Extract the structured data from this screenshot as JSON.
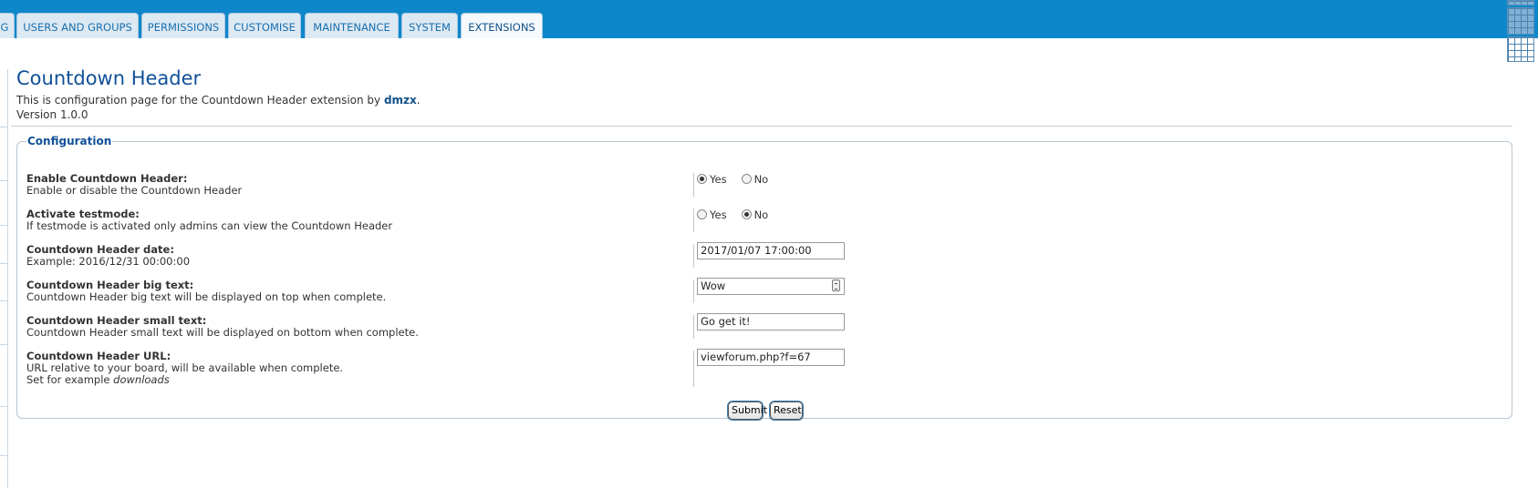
{
  "tabs": [
    {
      "label": "G"
    },
    {
      "label": "USERS AND GROUPS"
    },
    {
      "label": "PERMISSIONS"
    },
    {
      "label": "CUSTOMISE"
    },
    {
      "label": "MAINTENANCE"
    },
    {
      "label": "SYSTEM"
    },
    {
      "label": "EXTENSIONS",
      "active": true
    }
  ],
  "page": {
    "title": "Countdown Header",
    "intro_prefix": "This is configuration page for the Countdown Header extension by ",
    "author": "dmzx",
    "intro_suffix": ".",
    "version": "Version 1.0.0"
  },
  "config": {
    "legend": "Configuration",
    "enable": {
      "title": "Enable Countdown Header:",
      "desc": "Enable or disable the Countdown Header",
      "yes_label": "Yes",
      "no_label": "No",
      "selected": "Yes"
    },
    "testmode": {
      "title": "Activate testmode:",
      "desc": "If testmode is activated only admins can view the Countdown Header",
      "yes_label": "Yes",
      "no_label": "No",
      "selected": "No"
    },
    "date": {
      "title": "Countdown Header date:",
      "desc": "Example: 2016/12/31 00:00:00",
      "value": "2017/01/07 17:00:00"
    },
    "big_text": {
      "title": "Countdown Header big text:",
      "desc": "Countdown Header big text will be displayed on top when complete.",
      "value": "Wow"
    },
    "small_text": {
      "title": "Countdown Header small text:",
      "desc": "Countdown Header small text will be displayed on bottom when complete.",
      "value": "Go get it!"
    },
    "url": {
      "title": "Countdown Header URL:",
      "desc": "URL relative to your board, will be available when complete.",
      "desc2_prefix": "Set for example ",
      "desc2_example": "downloads",
      "value": "viewforum.php?f=67"
    },
    "submit_label": "Submit",
    "reset_label": "Reset"
  },
  "colors": {
    "tabbar": "#0e87ca",
    "title": "#115098",
    "tab_text": "#1a6fae"
  }
}
